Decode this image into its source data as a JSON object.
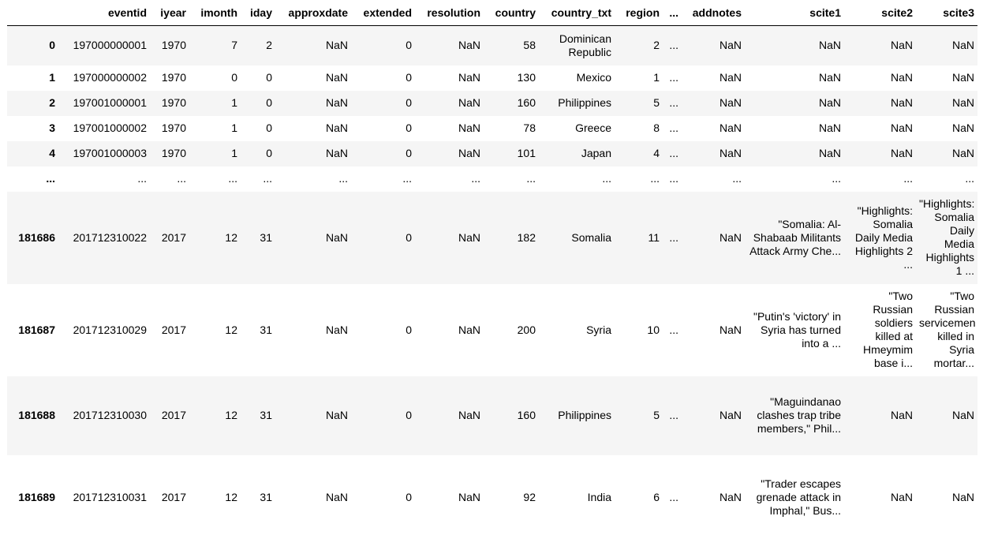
{
  "columns": [
    "",
    "eventid",
    "iyear",
    "imonth",
    "iday",
    "approxdate",
    "extended",
    "resolution",
    "country",
    "country_txt",
    "region",
    "...",
    "addnotes",
    "scite1",
    "scite2",
    "scite3"
  ],
  "rows": [
    {
      "idx": "0",
      "cells": [
        "197000000001",
        "1970",
        "7",
        "2",
        "NaN",
        "0",
        "NaN",
        "58",
        "Dominican Republic",
        "2",
        "...",
        "NaN",
        "NaN",
        "NaN",
        "NaN"
      ]
    },
    {
      "idx": "1",
      "cells": [
        "197000000002",
        "1970",
        "0",
        "0",
        "NaN",
        "0",
        "NaN",
        "130",
        "Mexico",
        "1",
        "...",
        "NaN",
        "NaN",
        "NaN",
        "NaN"
      ]
    },
    {
      "idx": "2",
      "cells": [
        "197001000001",
        "1970",
        "1",
        "0",
        "NaN",
        "0",
        "NaN",
        "160",
        "Philippines",
        "5",
        "...",
        "NaN",
        "NaN",
        "NaN",
        "NaN"
      ]
    },
    {
      "idx": "3",
      "cells": [
        "197001000002",
        "1970",
        "1",
        "0",
        "NaN",
        "0",
        "NaN",
        "78",
        "Greece",
        "8",
        "...",
        "NaN",
        "NaN",
        "NaN",
        "NaN"
      ]
    },
    {
      "idx": "4",
      "cells": [
        "197001000003",
        "1970",
        "1",
        "0",
        "NaN",
        "0",
        "NaN",
        "101",
        "Japan",
        "4",
        "...",
        "NaN",
        "NaN",
        "NaN",
        "NaN"
      ]
    },
    {
      "idx": "...",
      "cells": [
        "...",
        "...",
        "...",
        "...",
        "...",
        "...",
        "...",
        "...",
        "...",
        "...",
        "...",
        "...",
        "...",
        "...",
        "..."
      ]
    },
    {
      "idx": "181686",
      "cells": [
        "201712310022",
        "2017",
        "12",
        "31",
        "NaN",
        "0",
        "NaN",
        "182",
        "Somalia",
        "11",
        "...",
        "NaN",
        "\"Somalia: Al-Shabaab Militants Attack Army Che...",
        "\"Highlights: Somalia Daily Media Highlights 2 ...",
        "\"Highlights: Somalia Daily Media Highlights 1 ..."
      ]
    },
    {
      "idx": "181687",
      "cells": [
        "201712310029",
        "2017",
        "12",
        "31",
        "NaN",
        "0",
        "NaN",
        "200",
        "Syria",
        "10",
        "...",
        "NaN",
        "\"Putin's 'victory' in Syria has turned into a ...",
        "\"Two Russian soldiers killed at Hmeymim base i...",
        "\"Two Russian servicemen killed in Syria mortar..."
      ]
    },
    {
      "idx": "181688",
      "cells": [
        "201712310030",
        "2017",
        "12",
        "31",
        "NaN",
        "0",
        "NaN",
        "160",
        "Philippines",
        "5",
        "...",
        "NaN",
        "\"Maguindanao clashes trap tribe members,\" Phil...",
        "NaN",
        "NaN"
      ]
    },
    {
      "idx": "181689",
      "cells": [
        "201712310031",
        "2017",
        "12",
        "31",
        "NaN",
        "0",
        "NaN",
        "92",
        "India",
        "6",
        "...",
        "NaN",
        "\"Trader escapes grenade attack in Imphal,\" Bus...",
        "NaN",
        "NaN"
      ]
    }
  ]
}
